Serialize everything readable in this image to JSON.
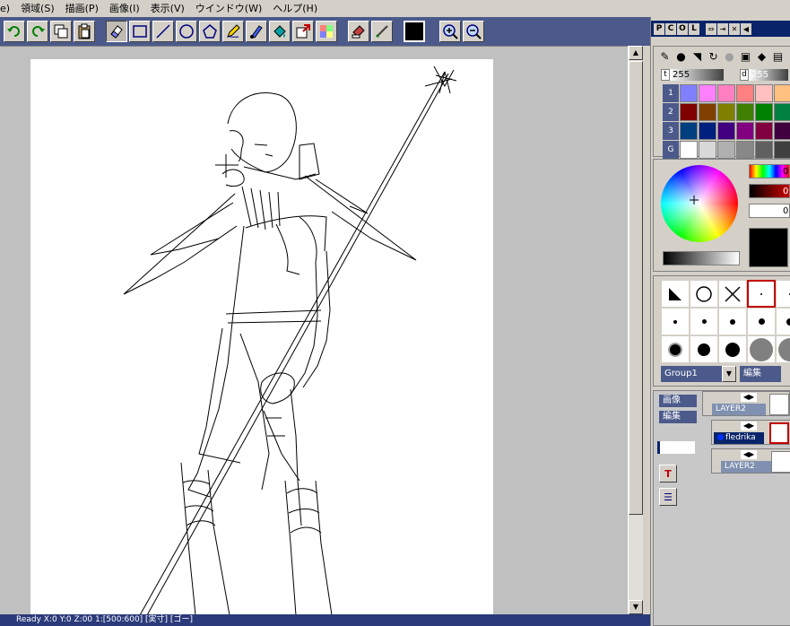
{
  "menubar": {
    "items": [
      "e)",
      "領域(S)",
      "描画(P)",
      "画像(I)",
      "表示(V)",
      "ウインドウ(W)",
      "ヘルプ(H)"
    ]
  },
  "toolbar": {
    "buttons": [
      "undo-icon",
      "redo-icon",
      "copy-icon",
      "paste-icon",
      "eraser-icon",
      "rectangle-icon",
      "line-icon",
      "ellipse-icon",
      "polygon-icon",
      "pen-icon",
      "brush-icon",
      "fill-icon",
      "transform-icon",
      "pattern-icon",
      "stamp-icon",
      "smudge-icon",
      "zoom-in-icon",
      "zoom-out-icon"
    ],
    "active": "eraser-icon",
    "current_color": "#000000"
  },
  "palette": {
    "tabs": [
      "P",
      "C",
      "O",
      "L"
    ],
    "t_label": "t",
    "t_value": "255",
    "d_label": "d",
    "d_value": "255",
    "row_labels": [
      "1",
      "2",
      "3",
      "G"
    ],
    "rows": [
      [
        "#8080ff",
        "#ff80ff",
        "#ff80c0",
        "#ff8080",
        "#ffc0c0",
        "#ffc080"
      ],
      [
        "#800000",
        "#804000",
        "#808000",
        "#408000",
        "#008000",
        "#008040"
      ],
      [
        "#004080",
        "#002080",
        "#400080",
        "#800080",
        "#800040",
        "#400040"
      ],
      [
        "#ffffff",
        "#d8d8d8",
        "#b0b0b0",
        "#888888",
        "#606060",
        "#404040"
      ]
    ]
  },
  "color_panel": {
    "hue_value": "0",
    "sat_value": "0",
    "val_value": "0",
    "current": "#000000"
  },
  "brush_tips": {
    "group_label": "Group1",
    "edit_label": "編集"
  },
  "layers": {
    "image_label": "画像",
    "edit_label": "編集",
    "items": [
      {
        "name": "LAYER2",
        "active": false
      },
      {
        "name": "fledrika",
        "active": true
      },
      {
        "name": "LAYER2",
        "active": false
      }
    ]
  },
  "status": {
    "text": "Ready   X:0  Y:0  Z:00   1:[500:600] [実寸] [ゴー]"
  }
}
